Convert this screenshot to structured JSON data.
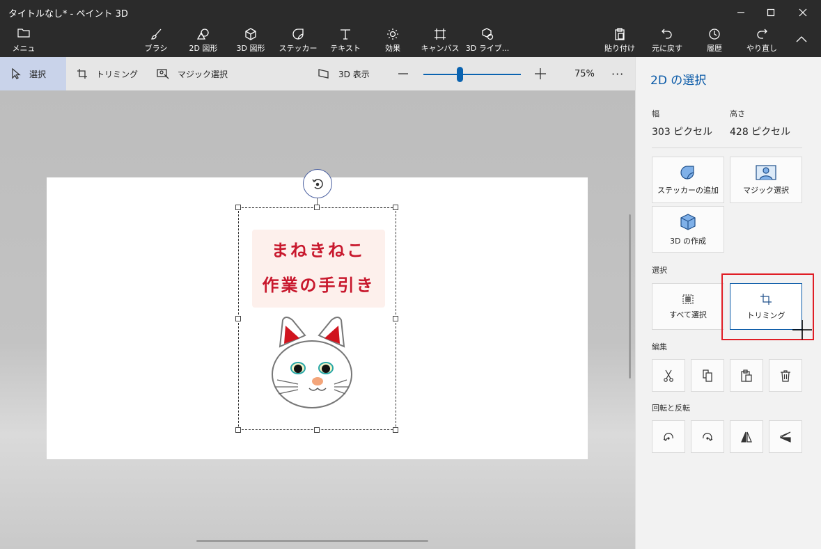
{
  "app": {
    "title": "タイトルなし* - ペイント 3D"
  },
  "ribbon": {
    "menu_label": "メニュー",
    "tools": [
      {
        "label": "ブラシ",
        "icon": "brush-icon"
      },
      {
        "label": "2D 図形",
        "icon": "2d-shapes-icon"
      },
      {
        "label": "3D 図形",
        "icon": "3d-shapes-icon"
      },
      {
        "label": "ステッカー",
        "icon": "sticker-icon"
      },
      {
        "label": "テキスト",
        "icon": "text-icon"
      },
      {
        "label": "効果",
        "icon": "effects-icon"
      },
      {
        "label": "キャンバス",
        "icon": "canvas-icon"
      },
      {
        "label": "3D ライブ...",
        "icon": "3d-library-icon"
      }
    ],
    "actions": [
      {
        "label": "貼り付け",
        "icon": "paste-icon"
      },
      {
        "label": "元に戻す",
        "icon": "undo-icon"
      },
      {
        "label": "履歴",
        "icon": "history-icon"
      },
      {
        "label": "やり直し",
        "icon": "redo-icon"
      }
    ]
  },
  "subbar": {
    "select": "選択",
    "crop": "トリミング",
    "magic_select": "マジック選択",
    "view_3d": "3D 表示",
    "zoom_minus": "—",
    "zoom_plus": "+",
    "zoom_value": "75%",
    "zoom_level": 0.35,
    "more": "···"
  },
  "canvas": {
    "card_line1": "まねきねこ",
    "card_line2": "作業の手引き"
  },
  "panel": {
    "title": "2D の選択",
    "width_label": "幅",
    "width_value": "303 ピクセル",
    "height_label": "高さ",
    "height_value": "428 ピクセル",
    "add_sticker": "ステッカーの追加",
    "magic_select": "マジック選択",
    "make_3d": "3D の作成",
    "section_select": "選択",
    "select_all": "すべて選択",
    "crop": "トリミング",
    "section_edit": "編集",
    "section_rotate": "回転と反転"
  }
}
